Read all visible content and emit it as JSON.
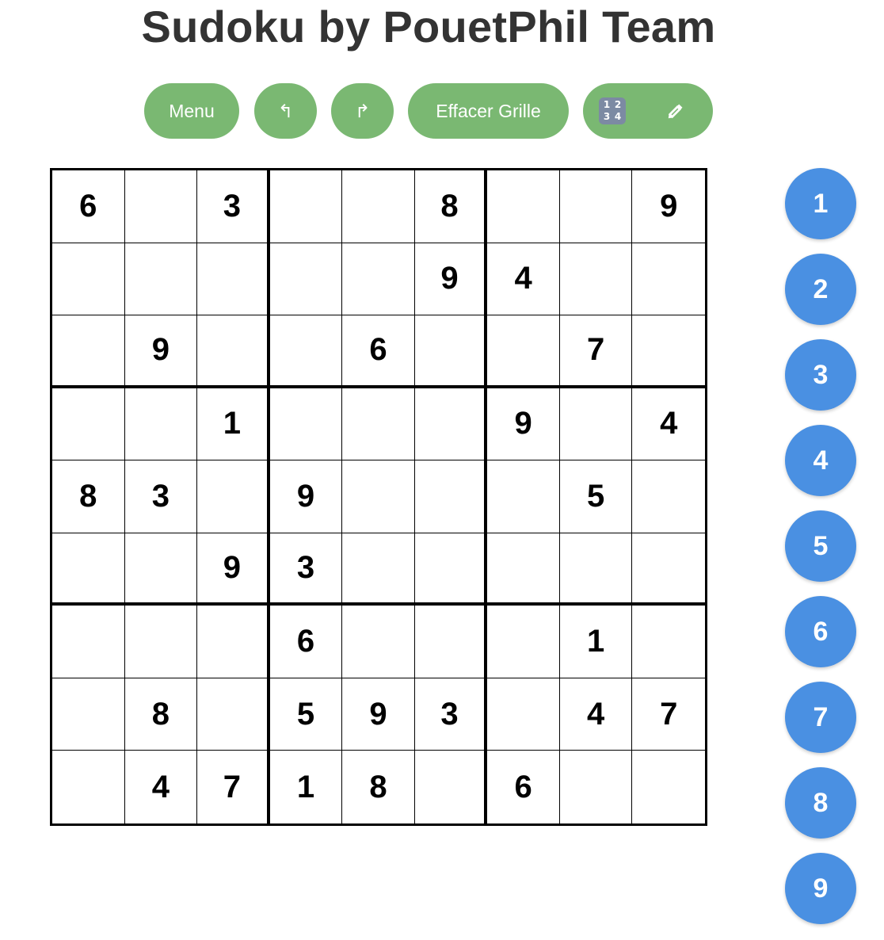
{
  "title": "Sudoku by PouetPhil Team",
  "toolbar": {
    "menu_label": "Menu",
    "undo_label": "↰",
    "redo_label": "↱",
    "clear_label": "Effacer Grille",
    "mode_icons": [
      "numpad-icon",
      "pencil-icon"
    ],
    "numpad_glyph": [
      "1",
      "2",
      "3",
      "4"
    ]
  },
  "colors": {
    "toolbar_button": "#7ab872",
    "number_button": "#4a90e2",
    "title": "#333333"
  },
  "grid": [
    [
      "6",
      "",
      "3",
      "",
      "",
      "8",
      "",
      "",
      "9"
    ],
    [
      "",
      "",
      "",
      "",
      "",
      "9",
      "4",
      "",
      ""
    ],
    [
      "",
      "9",
      "",
      "",
      "6",
      "",
      "",
      "7",
      ""
    ],
    [
      "",
      "",
      "1",
      "",
      "",
      "",
      "9",
      "",
      "4"
    ],
    [
      "8",
      "3",
      "",
      "9",
      "",
      "",
      "",
      "5",
      ""
    ],
    [
      "",
      "",
      "9",
      "3",
      "",
      "",
      "",
      "",
      ""
    ],
    [
      "",
      "",
      "",
      "6",
      "",
      "",
      "",
      "1",
      ""
    ],
    [
      "",
      "8",
      "",
      "5",
      "9",
      "3",
      "",
      "4",
      "7"
    ],
    [
      "",
      "4",
      "7",
      "1",
      "8",
      "",
      "6",
      "",
      ""
    ]
  ],
  "number_buttons": [
    "1",
    "2",
    "3",
    "4",
    "5",
    "6",
    "7",
    "8",
    "9"
  ]
}
